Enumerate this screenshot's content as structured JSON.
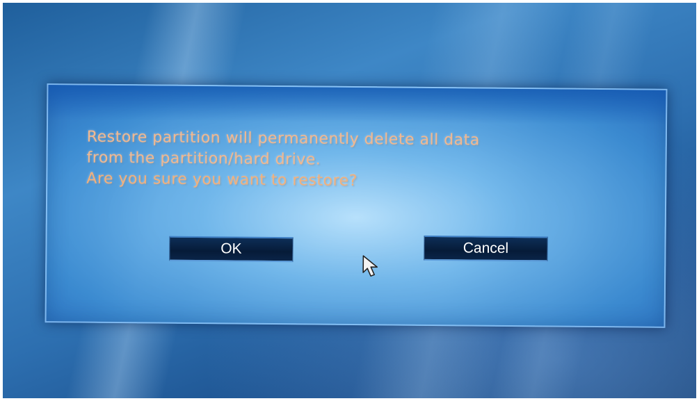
{
  "dialog": {
    "message_lines": [
      "Restore partition will permanently delete all data",
      "from the partition/hard drive.",
      "Are you sure you want to restore?"
    ],
    "ok_label": "OK",
    "cancel_label": "Cancel"
  },
  "icons": {
    "cursor": "mouse-pointer-icon"
  },
  "colors": {
    "message_text": "#f1b890",
    "button_bg": "#061b38",
    "background_blue": "#2d6fb0"
  }
}
